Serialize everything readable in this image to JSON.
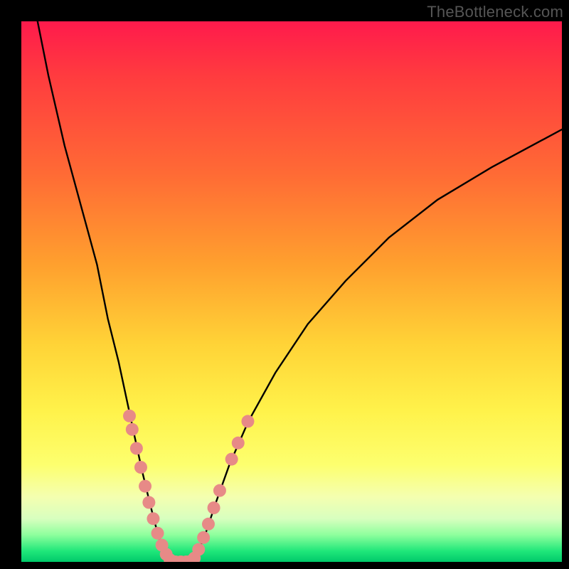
{
  "watermark": "TheBottleneck.com",
  "colors": {
    "curve_stroke": "#000000",
    "dot_fill": "#e78a87",
    "dot_stroke": "#c96f6c"
  },
  "chart_data": {
    "type": "line",
    "title": "",
    "xlabel": "",
    "ylabel": "",
    "xlim": [
      0,
      100
    ],
    "ylim": [
      0,
      100
    ],
    "series": [
      {
        "name": "left-branch",
        "x": [
          3,
          5,
          8,
          11,
          14,
          16,
          18,
          19.5,
          21,
          22.3,
          23.5,
          24.5,
          25.3,
          26,
          26.6,
          27,
          27.5
        ],
        "y": [
          100,
          90,
          77,
          66,
          55,
          45,
          37,
          30,
          23,
          17,
          12,
          8,
          5,
          3,
          1.5,
          0.6,
          0.1
        ]
      },
      {
        "name": "floor",
        "x": [
          27.5,
          28.5,
          29.5,
          30.5,
          31.5
        ],
        "y": [
          0.1,
          0,
          0,
          0,
          0.1
        ]
      },
      {
        "name": "right-branch",
        "x": [
          31.5,
          32.5,
          34,
          36,
          38.5,
          42,
          47,
          53,
          60,
          68,
          77,
          87,
          100
        ],
        "y": [
          0.1,
          1.5,
          5,
          11,
          18,
          26,
          35,
          44,
          52,
          60,
          67,
          73,
          80
        ]
      }
    ],
    "dots_left": [
      {
        "x": 20.0,
        "y": 27
      },
      {
        "x": 20.5,
        "y": 24.5
      },
      {
        "x": 21.3,
        "y": 21
      },
      {
        "x": 22.1,
        "y": 17.5
      },
      {
        "x": 22.9,
        "y": 14
      },
      {
        "x": 23.6,
        "y": 11
      },
      {
        "x": 24.4,
        "y": 8
      },
      {
        "x": 25.2,
        "y": 5.3
      },
      {
        "x": 26.0,
        "y": 3.1
      },
      {
        "x": 26.8,
        "y": 1.4
      },
      {
        "x": 27.5,
        "y": 0.4
      },
      {
        "x": 28.5,
        "y": 0.0
      },
      {
        "x": 29.5,
        "y": 0.0
      },
      {
        "x": 30.5,
        "y": 0.0
      },
      {
        "x": 31.3,
        "y": 0.1
      }
    ],
    "dots_right": [
      {
        "x": 32.0,
        "y": 0.7
      },
      {
        "x": 32.8,
        "y": 2.3
      },
      {
        "x": 33.7,
        "y": 4.5
      },
      {
        "x": 34.6,
        "y": 7.0
      },
      {
        "x": 35.6,
        "y": 10.0
      },
      {
        "x": 36.7,
        "y": 13.2
      },
      {
        "x": 38.9,
        "y": 19.0
      },
      {
        "x": 40.1,
        "y": 22.0
      },
      {
        "x": 41.9,
        "y": 26.0
      }
    ]
  }
}
